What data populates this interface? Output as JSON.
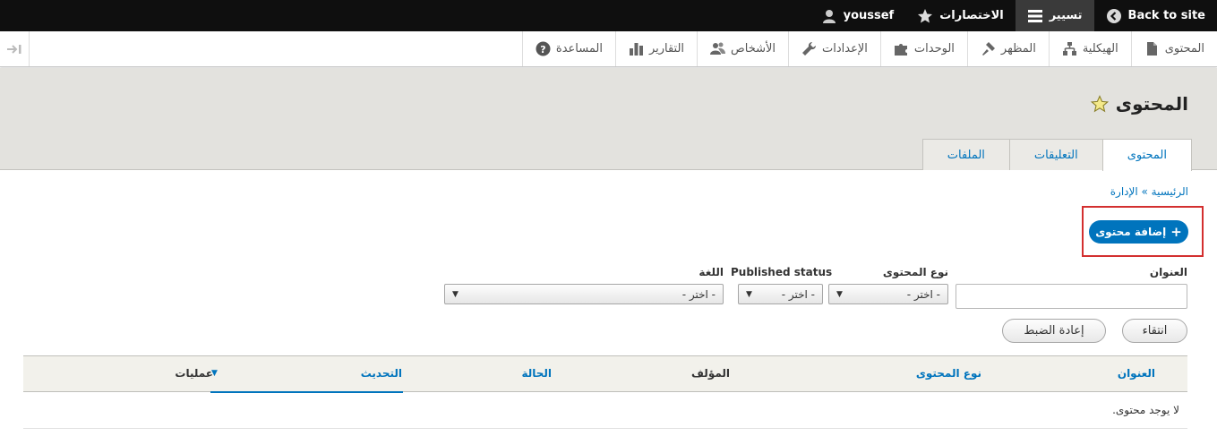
{
  "toolbar": {
    "back_to_site": "Back to site",
    "manage": "تسيير",
    "shortcuts": "الاختصارات",
    "user": "youssef"
  },
  "tray": {
    "items": [
      {
        "label": "المحتوى",
        "icon": "file-icon"
      },
      {
        "label": "الهيكلية",
        "icon": "sitemap-icon"
      },
      {
        "label": "المظهر",
        "icon": "paintbrush-icon"
      },
      {
        "label": "الوحدات",
        "icon": "puzzle-icon"
      },
      {
        "label": "الإعدادات",
        "icon": "wrench-icon"
      },
      {
        "label": "الأشخاص",
        "icon": "people-icon"
      },
      {
        "label": "التقارير",
        "icon": "bar-chart-icon"
      },
      {
        "label": "المساعدة",
        "icon": "help-icon"
      }
    ]
  },
  "page": {
    "title": "المحتوى",
    "tabs": [
      "المحتوى",
      "التعليقات",
      "الملفات"
    ],
    "breadcrumb": "الرئيسية » الإدارة",
    "add_button": "إضافة محتوى"
  },
  "filters": {
    "title_label": "العنوان",
    "type_label": "نوع المحتوى",
    "status_label": "Published status",
    "language_label": "اللغة",
    "type_value": "- اختر -",
    "status_value": "- اختر -",
    "language_value": "- اختر -",
    "filter_button": "انتقاء",
    "reset_button": "إعادة الضبط"
  },
  "table": {
    "columns": [
      "العنوان",
      "نوع المحتوى",
      "المؤلف",
      "الحالة",
      "التحديث",
      "عمليات"
    ],
    "empty": "لا يوجد محتوى."
  },
  "colors": {
    "accent": "#0074bd",
    "highlight_border": "#d32f2f",
    "toolbar_bg": "#0f0f0f"
  }
}
